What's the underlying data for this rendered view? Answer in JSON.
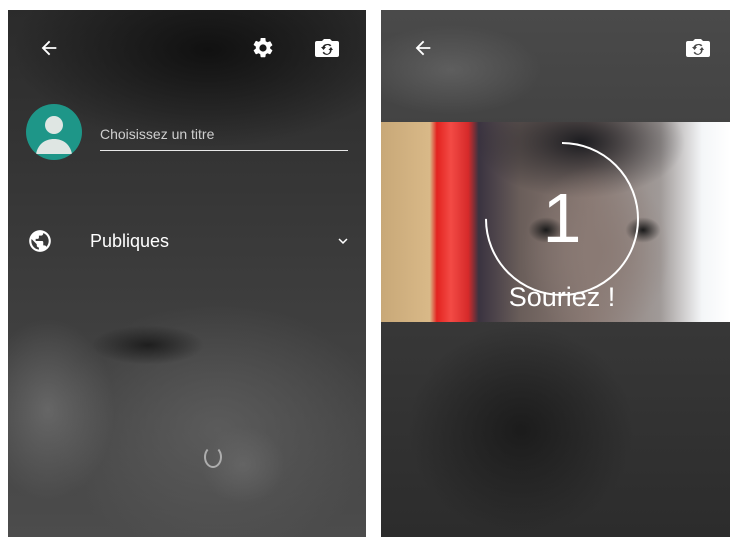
{
  "left_screen": {
    "title_placeholder": "Choisissez un titre",
    "visibility_label": "Publiques",
    "icons": {
      "back": "arrow-back-icon",
      "settings": "gear-icon",
      "switch_camera": "switch-camera-icon",
      "avatar": "person-icon",
      "visibility": "globe-icon",
      "dropdown": "chevron-down-icon"
    }
  },
  "right_screen": {
    "countdown": "1",
    "countdown_progress": 0.75,
    "message": "Souriez !",
    "icons": {
      "back": "arrow-back-icon",
      "switch_camera": "switch-camera-icon"
    }
  },
  "colors": {
    "avatar_background": "#1e9688",
    "icon_color": "#ffffff"
  }
}
